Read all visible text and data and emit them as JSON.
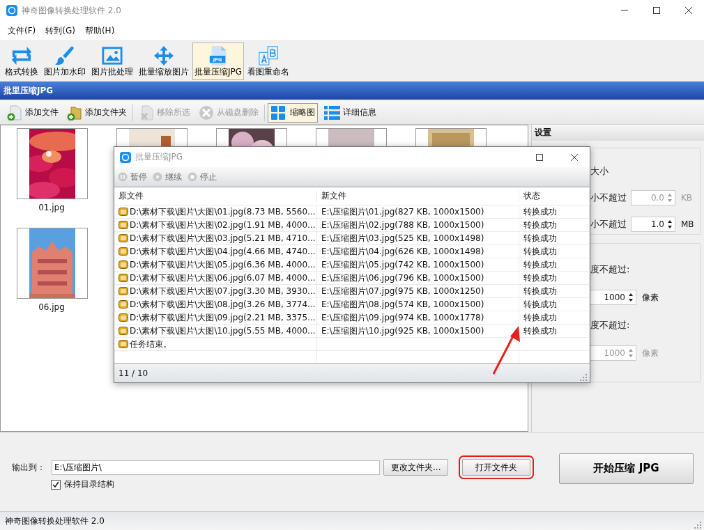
{
  "window": {
    "title": "神奇图像转换处理软件 2.0"
  },
  "menu": [
    "文件(F)",
    "转到(G)",
    "帮助(H)"
  ],
  "toolbar": [
    {
      "label": "格式转换",
      "selected": false
    },
    {
      "label": "图片加水印",
      "selected": false
    },
    {
      "label": "图片批处理",
      "selected": false
    },
    {
      "label": "批量缩放图片",
      "selected": false
    },
    {
      "label": "批量压缩JPG",
      "selected": true,
      "icon_text": "JPG"
    },
    {
      "label": "看图重命名",
      "selected": false
    }
  ],
  "section_title": "批里压缩JPG",
  "actions": [
    {
      "label": "添加文件",
      "disabled": false,
      "selected": false
    },
    {
      "label": "添加文件夹",
      "disabled": false,
      "selected": false
    },
    {
      "label": "移除所选",
      "disabled": true,
      "selected": false
    },
    {
      "label": "从磁盘删除",
      "disabled": true,
      "selected": false
    },
    {
      "label": "缩略图",
      "disabled": false,
      "selected": true
    },
    {
      "label": "详细信息",
      "disabled": false,
      "selected": false
    }
  ],
  "thumbnails": [
    {
      "kind": "picture",
      "caption": "01.jpg"
    },
    {
      "kind": "picture"
    },
    {
      "kind": "picture"
    },
    {
      "kind": "picture"
    },
    {
      "kind": "picture"
    },
    {
      "kind": "picture",
      "caption": "06.jpg"
    }
  ],
  "settings": {
    "heading": "设置",
    "groups": [
      {
        "rows": [
          {
            "kind": "label",
            "text": "大小"
          },
          {
            "kind": "spinner",
            "label": "小不超过",
            "value": "0.0",
            "unit": "KB",
            "disabled": true
          },
          {
            "kind": "spinner",
            "label": "小不超过",
            "value": "1.0",
            "unit": "MB",
            "disabled": false
          }
        ]
      },
      {
        "rows": [
          {
            "kind": "label",
            "text": "度不超过:"
          },
          {
            "kind": "spinner",
            "value": "1000",
            "unit": "像素",
            "disabled": false
          },
          {
            "kind": "label",
            "text": "度不超过:"
          },
          {
            "kind": "spinner",
            "value": "1000",
            "unit": "像素",
            "disabled": true
          }
        ]
      }
    ]
  },
  "output": {
    "label": "输出到：",
    "path": "E:\\压缩图片\\",
    "change_button": "更改文件夹...",
    "open_button": {
      "label": "打开文件夹",
      "highlighted": true
    },
    "keep_structure": {
      "label": "保持目录结构",
      "checked": true
    }
  },
  "start_button": "开始压缩 JPG",
  "status_bar": "神奇图像转换处理软件 2.0",
  "dialog": {
    "title": "批量压缩JPG",
    "controls": [
      {
        "label": "暂停",
        "disabled": true
      },
      {
        "label": "继续",
        "disabled": true
      },
      {
        "label": "停止",
        "disabled": true
      }
    ],
    "columns": [
      "原文件",
      "新文件",
      "状态"
    ],
    "rows": [
      {
        "source": "D:\\素材下载\\图片\\大图\\01.jpg(8.73 MB, 5560...",
        "target": "E:\\压缩图片\\01.jpg(827 KB, 1000x1500)",
        "status": "转换成功"
      },
      {
        "source": "D:\\素材下载\\图片\\大图\\02.jpg(1.91 MB, 4000...",
        "target": "E:\\压缩图片\\02.jpg(788 KB, 1000x1500)",
        "status": "转换成功"
      },
      {
        "source": "D:\\素材下载\\图片\\大图\\03.jpg(5.21 MB, 4710...",
        "target": "E:\\压缩图片\\03.jpg(525 KB, 1000x1498)",
        "status": "转换成功"
      },
      {
        "source": "D:\\素材下载\\图片\\大图\\04.jpg(4.66 MB, 4740...",
        "target": "E:\\压缩图片\\04.jpg(626 KB, 1000x1498)",
        "status": "转换成功"
      },
      {
        "source": "D:\\素材下载\\图片\\大图\\05.jpg(6.36 MB, 4000...",
        "target": "E:\\压缩图片\\05.jpg(742 KB, 1000x1500)",
        "status": "转换成功"
      },
      {
        "source": "D:\\素材下载\\图片\\大图\\06.jpg(6.07 MB, 4000...",
        "target": "E:\\压缩图片\\06.jpg(796 KB, 1000x1500)",
        "status": "转换成功"
      },
      {
        "source": "D:\\素材下载\\图片\\大图\\07.jpg(3.30 MB, 3930...",
        "target": "E:\\压缩图片\\07.jpg(975 KB, 1000x1250)",
        "status": "转换成功"
      },
      {
        "source": "D:\\素材下载\\图片\\大图\\08.jpg(3.26 MB, 3774...",
        "target": "E:\\压缩图片\\08.jpg(574 KB, 1000x1500)",
        "status": "转换成功"
      },
      {
        "source": "D:\\素材下载\\图片\\大图\\09.jpg(2.21 MB, 3375...",
        "target": "E:\\压缩图片\\09.jpg(974 KB, 1000x1778)",
        "status": "转换成功"
      },
      {
        "source": "D:\\素材下载\\图片\\大图\\10.jpg(5.55 MB, 4000...",
        "target": "E:\\压缩图片\\10.jpg(925 KB, 1000x1500)",
        "status": "转换成功"
      }
    ],
    "footer_message": "任务结束。",
    "counter": "11 / 10"
  }
}
